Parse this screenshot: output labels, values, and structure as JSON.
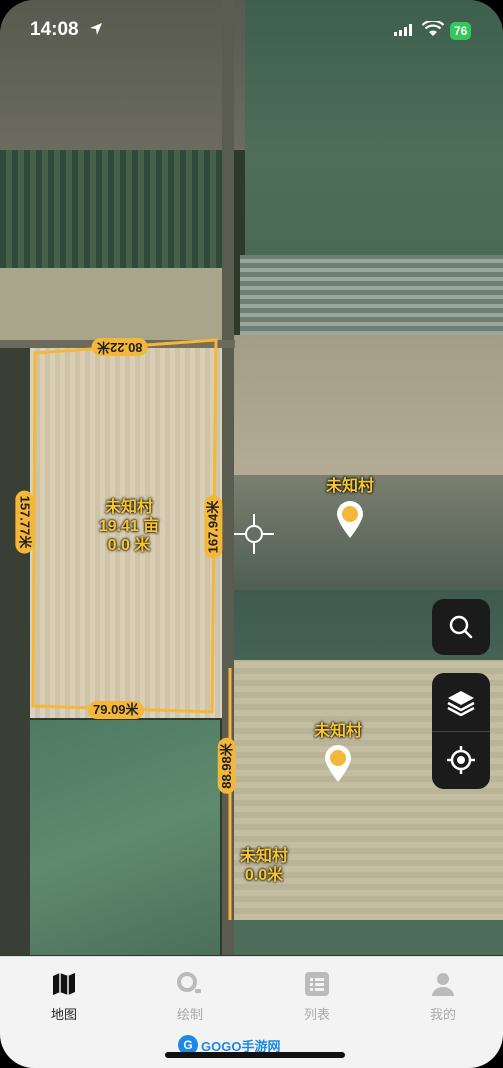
{
  "status_bar": {
    "time": "14:08",
    "battery": "76"
  },
  "map": {
    "selected_field": {
      "name": "未知村",
      "area": "19.41 亩",
      "perimeter": "0.0 米",
      "edges": {
        "top": "80.22米",
        "left": "157.77米",
        "right": "167.94米",
        "bottom": "79.09米"
      }
    },
    "side_edge_label": "88.98米",
    "pins": [
      {
        "label": "未知村"
      },
      {
        "label": "未知村"
      }
    ],
    "lower_field": {
      "name": "未知村",
      "perimeter": "0.0米"
    }
  },
  "controls": {
    "search": "search-icon",
    "layers": "layers-icon",
    "locate": "locate-icon"
  },
  "tabs": [
    {
      "label": "地图",
      "icon": "map-icon",
      "active": true
    },
    {
      "label": "绘制",
      "icon": "draw-icon",
      "active": false
    },
    {
      "label": "列表",
      "icon": "list-icon",
      "active": false
    },
    {
      "label": "我的",
      "icon": "profile-icon",
      "active": false
    }
  ],
  "watermark": {
    "logo": "G",
    "text": "GOGO手游网"
  },
  "colors": {
    "accent": "#f4b73a",
    "label": "#f7c531",
    "tabbar": "#f3f3f3",
    "button": "#1b1b1b"
  }
}
